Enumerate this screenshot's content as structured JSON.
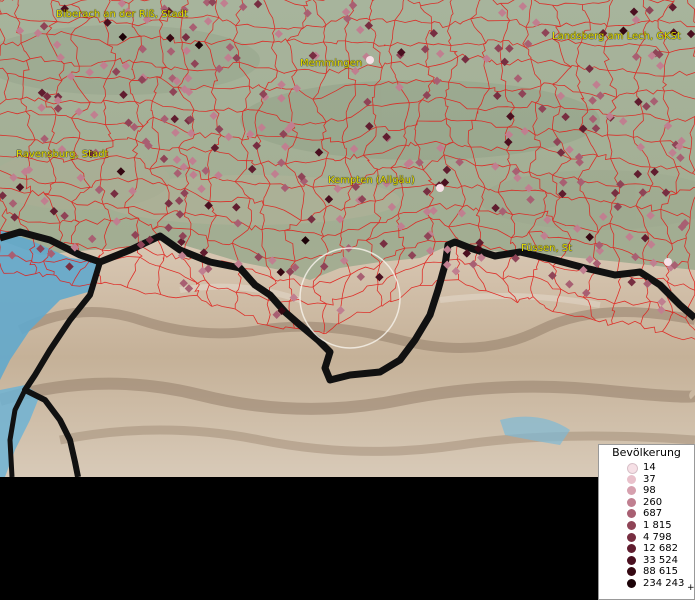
{
  "map": {
    "place_labels": [
      {
        "id": "biberach",
        "text": "Biberach an der Riß, Stadt"
      },
      {
        "id": "memmingen",
        "text": "Memmingen"
      },
      {
        "id": "landsberg",
        "text": "Landsberg am Lech, GKSt"
      },
      {
        "id": "ravensburg",
        "text": "Ravensburg, Stadt"
      },
      {
        "id": "kempten",
        "text": "Kempten (Allgäu)"
      },
      {
        "id": "fussen",
        "text": "Füssen, St"
      }
    ],
    "colors": {
      "boundary_red": "#e0201c",
      "border_black": "#111111",
      "lake_blue": "#62a8cc",
      "label_yellow": "#e8e000"
    }
  },
  "legend": {
    "title": "Bevölkerung",
    "plus_marker": "+",
    "classes": [
      {
        "label": "14",
        "color": "#f6e0e6"
      },
      {
        "label": "37",
        "color": "#e9c1cb"
      },
      {
        "label": "98",
        "color": "#d6a0ae"
      },
      {
        "label": "260",
        "color": "#c07f90"
      },
      {
        "label": "687",
        "color": "#a85f72"
      },
      {
        "label": "1 815",
        "color": "#8f4457"
      },
      {
        "label": "4 798",
        "color": "#772e41"
      },
      {
        "label": "12 682",
        "color": "#601d2f"
      },
      {
        "label": "33 524",
        "color": "#4a1020"
      },
      {
        "label": "88 615",
        "color": "#350812"
      },
      {
        "label": "234 243",
        "color": "#1c0308"
      }
    ]
  }
}
